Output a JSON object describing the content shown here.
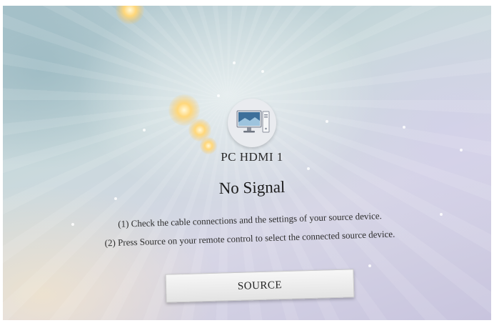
{
  "source": {
    "icon": "pc-monitor-icon",
    "name": "PC  HDMI 1"
  },
  "message": {
    "title": "No Signal",
    "instructions": [
      "(1) Check the cable connections and the settings of your source device.",
      "(2) Press Source on your remote control to select the connected source device."
    ]
  },
  "button": {
    "label": "SOURCE"
  },
  "colors": {
    "background_top": "#a9c3cb",
    "background_bottom": "#c8c4de",
    "glow": "#ffd77a",
    "button_bg": "#eeeeee",
    "text": "#1c1c1c"
  }
}
